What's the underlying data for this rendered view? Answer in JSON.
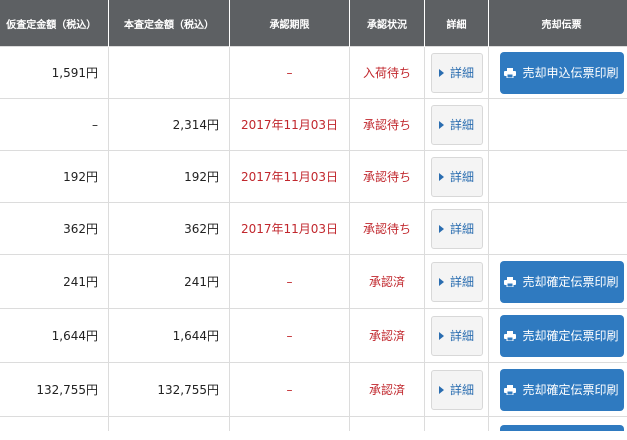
{
  "headers": [
    "仮査定金額（税込）",
    "本査定金額（税込）",
    "承認期限",
    "承認状況",
    "詳細",
    "売却伝票"
  ],
  "detail_label": "詳細",
  "rows": [
    {
      "provisional": "1,591円",
      "final": "",
      "deadline": "–",
      "status": "入荷待ち",
      "slip": "売却申込伝票印刷"
    },
    {
      "provisional": "–",
      "final": "2,314円",
      "deadline": "2017年11月03日",
      "status": "承認待ち",
      "slip": ""
    },
    {
      "provisional": "192円",
      "final": "192円",
      "deadline": "2017年11月03日",
      "status": "承認待ち",
      "slip": ""
    },
    {
      "provisional": "362円",
      "final": "362円",
      "deadline": "2017年11月03日",
      "status": "承認待ち",
      "slip": ""
    },
    {
      "provisional": "241円",
      "final": "241円",
      "deadline": "–",
      "status": "承認済",
      "slip": "売却確定伝票印刷"
    },
    {
      "provisional": "1,644円",
      "final": "1,644円",
      "deadline": "–",
      "status": "承認済",
      "slip": "売却確定伝票印刷"
    },
    {
      "provisional": "132,755円",
      "final": "132,755円",
      "deadline": "–",
      "status": "承認済",
      "slip": "売却確定伝票印刷"
    }
  ],
  "colors": {
    "header_bg": "#5d6063",
    "status_red": "#c1272d",
    "button_blue": "#2f7ac0",
    "link_blue": "#2a6db0"
  },
  "icons": {
    "detail": "triangle-right-icon",
    "slip": "printer-icon"
  }
}
